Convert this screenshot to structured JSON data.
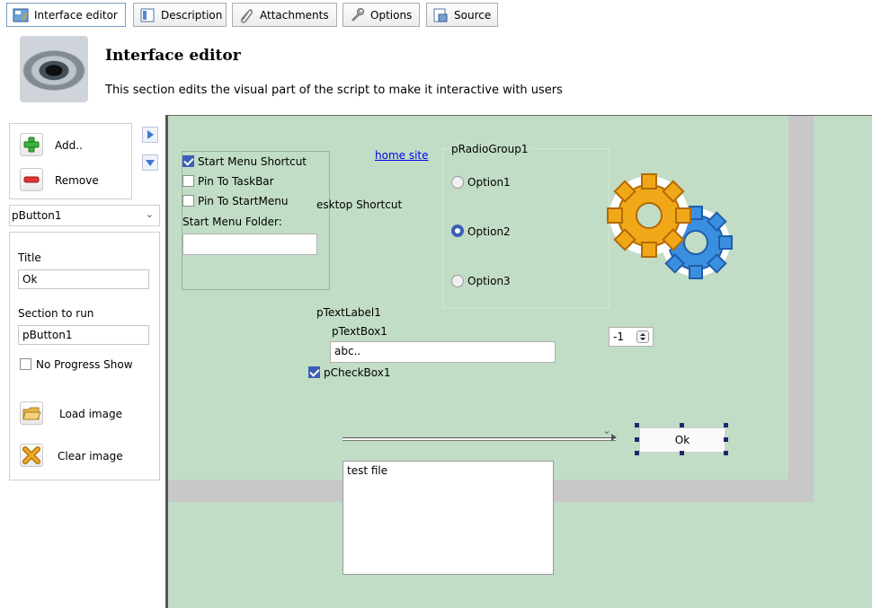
{
  "tabs": [
    {
      "label": "Interface editor",
      "icon": "interface-editor-icon",
      "active": true
    },
    {
      "label": "Description",
      "icon": "description-icon"
    },
    {
      "label": "Attachments",
      "icon": "paperclip-icon"
    },
    {
      "label": "Options",
      "icon": "wrench-icon"
    },
    {
      "label": "Source",
      "icon": "source-icon"
    }
  ],
  "header": {
    "title": "Interface editor",
    "subtitle": "This section edits the visual part of the script to make it interactive with users",
    "logo_icon": "eye-icon"
  },
  "left_panel": {
    "add_label": "Add..",
    "remove_label": "Remove",
    "selected_component": "pButton1",
    "title_label": "Title",
    "title_value": "Ok",
    "section_label": "Section to run",
    "section_value": "pButton1",
    "no_progress_label": "No Progress Show",
    "no_progress_checked": false,
    "load_image_label": "Load image",
    "clear_image_label": "Clear image"
  },
  "canvas": {
    "checkgroup": {
      "items": [
        {
          "label": "Start Menu Shortcut",
          "checked": true
        },
        {
          "label": "Pin To TaskBar",
          "checked": false
        },
        {
          "label": "Pin To StartMenu",
          "checked": false
        }
      ],
      "folder_label": "Start Menu Folder:",
      "folder_value": ""
    },
    "desktop_shortcut_text": "esktop Shortcut",
    "home_link": "home site",
    "radio_group": {
      "title": "pRadioGroup1",
      "options": [
        {
          "label": "Option1",
          "selected": false
        },
        {
          "label": "Option2",
          "selected": true
        },
        {
          "label": "Option3",
          "selected": false
        }
      ]
    },
    "text_label": "pTextLabel1",
    "textbox_label": "pTextBox1",
    "textbox_value": "abc..",
    "checkbox_label": "pCheckBox1",
    "checkbox_checked": true,
    "spin_value": "-1",
    "ok_button": "Ok",
    "memo_text": "test file",
    "gears_icon": "gears-icon"
  },
  "colors": {
    "canvas_bg": "#c2ddc6",
    "accent": "#3d5fb5",
    "link": "#0000ee"
  }
}
